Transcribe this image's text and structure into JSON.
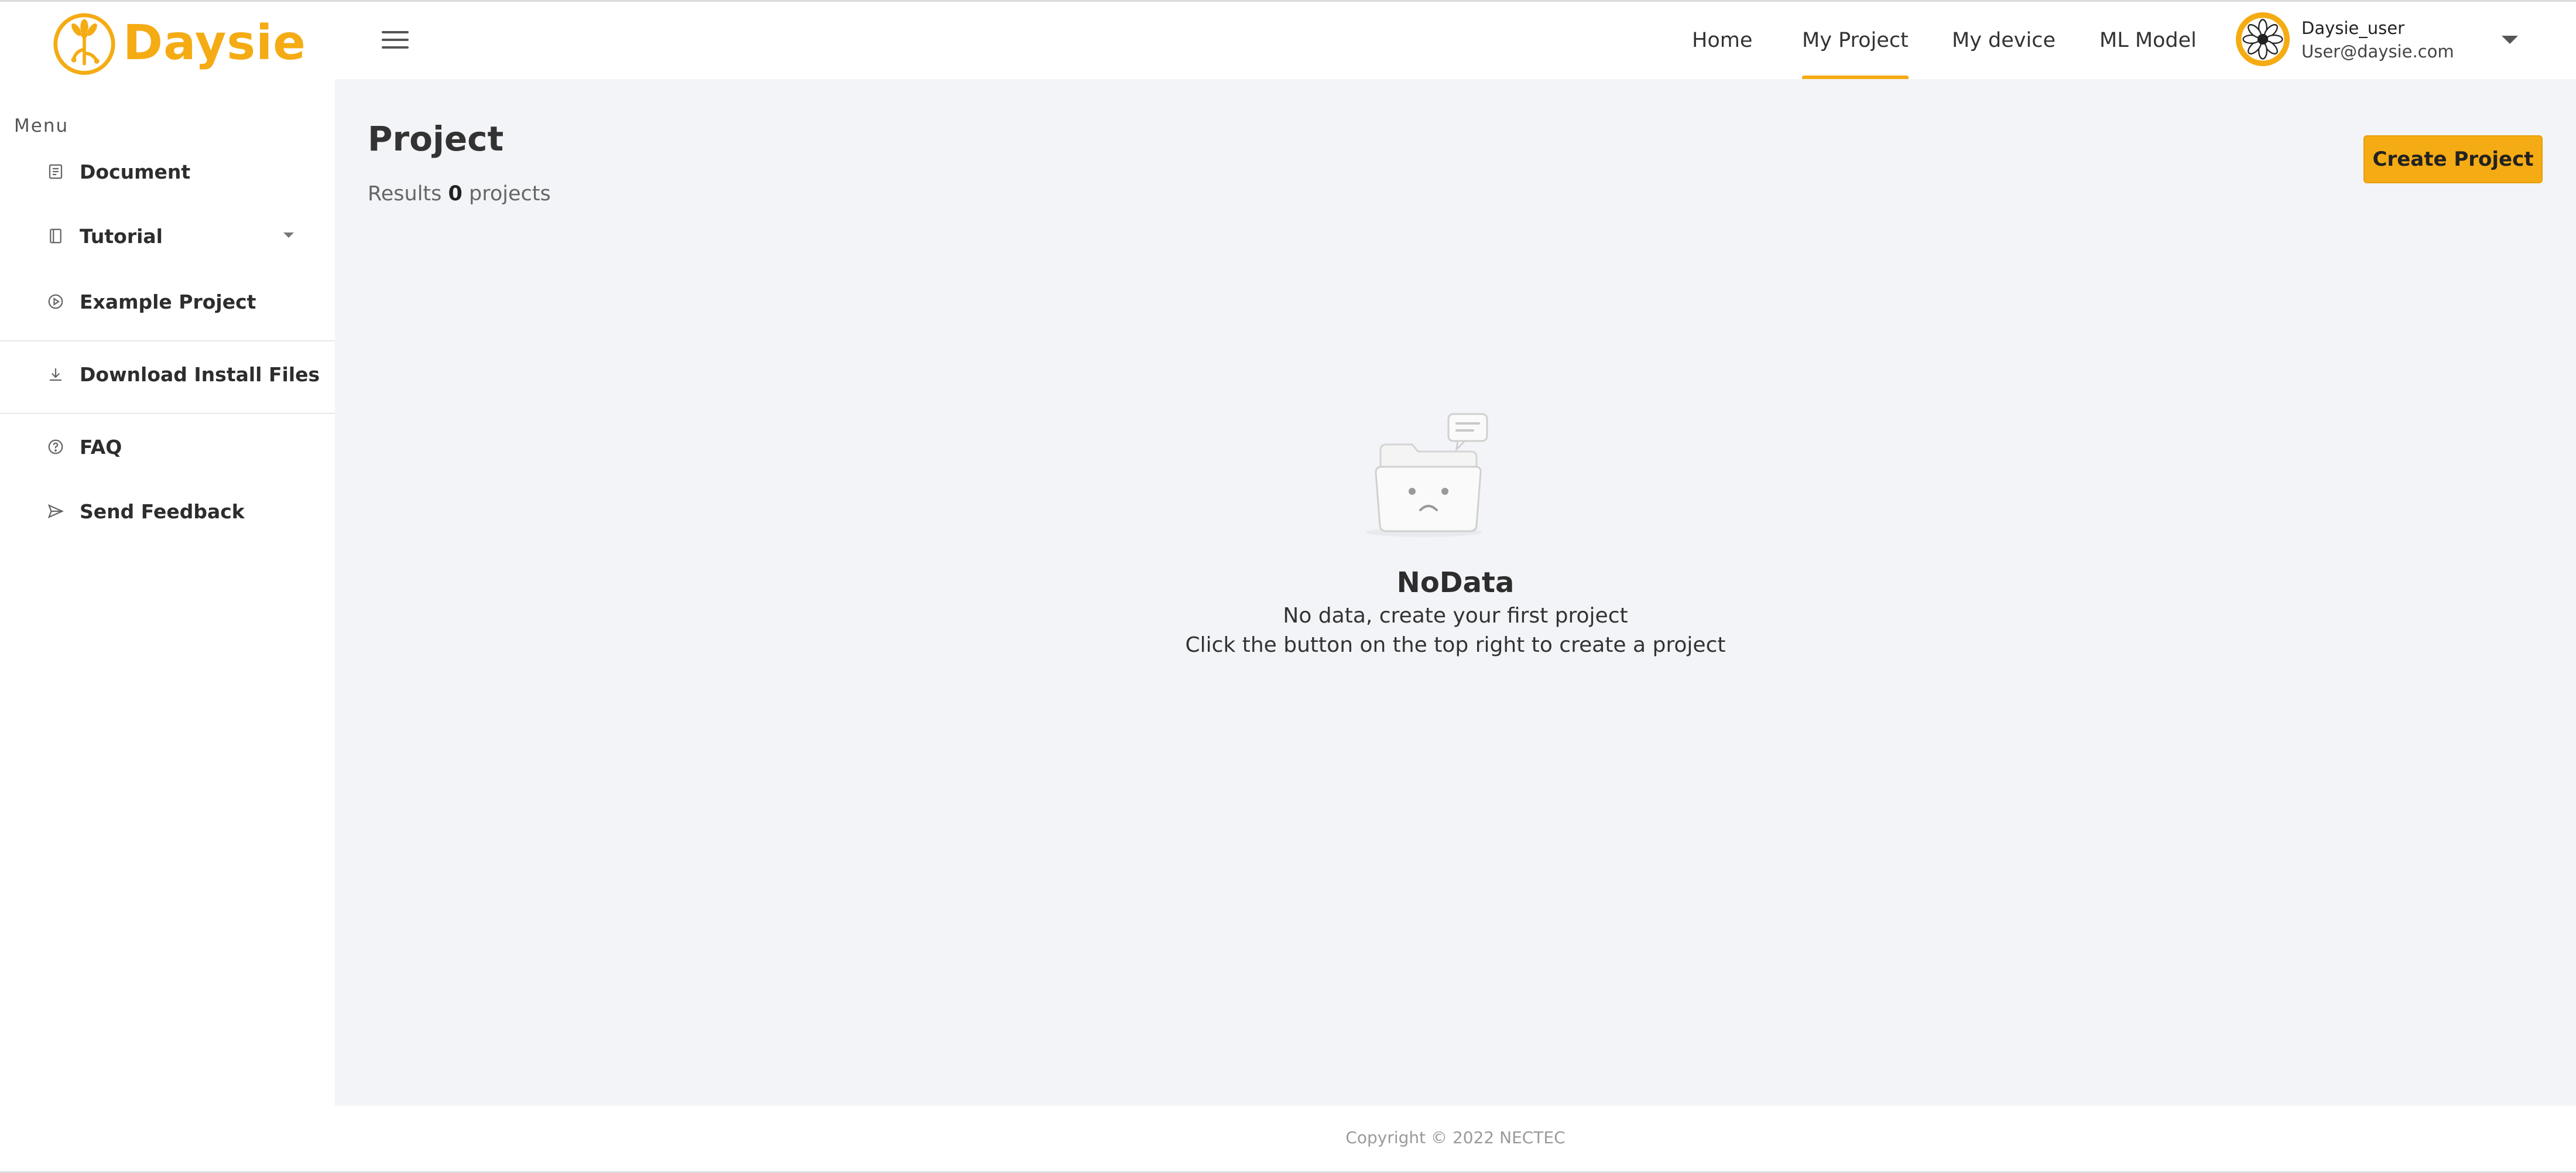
{
  "brand": {
    "name": "Daysie",
    "color": "#f5ab13"
  },
  "sidebar": {
    "caption": "Menu",
    "items": [
      {
        "label": "Document",
        "icon": "document-icon"
      },
      {
        "label": "Tutorial",
        "icon": "book-icon",
        "has_submenu": true
      },
      {
        "label": "Example Project",
        "icon": "play-circle-icon"
      },
      {
        "label": "Download Install Files",
        "icon": "download-icon"
      },
      {
        "label": "FAQ",
        "icon": "question-circle-icon"
      },
      {
        "label": "Send Feedback",
        "icon": "send-icon"
      }
    ]
  },
  "header": {
    "nav": [
      {
        "label": "Home",
        "active": false
      },
      {
        "label": "My Project",
        "active": true
      },
      {
        "label": "My device",
        "active": false
      },
      {
        "label": "ML Model",
        "active": false
      }
    ],
    "user": {
      "name": "Daysie_user",
      "email": "User@daysie.com",
      "avatar_icon": "flower-icon"
    }
  },
  "main": {
    "title": "Project",
    "results_prefix": "Results",
    "results_count": "0",
    "results_suffix": "projects",
    "create_button": "Create Project",
    "empty": {
      "title": "NoData",
      "line1": "No data, create your first project",
      "line2": "Click the button on the top right to create a project",
      "icon": "empty-folder-icon"
    }
  },
  "footer": {
    "copyright": "Copyright © 2022 NECTEC"
  }
}
